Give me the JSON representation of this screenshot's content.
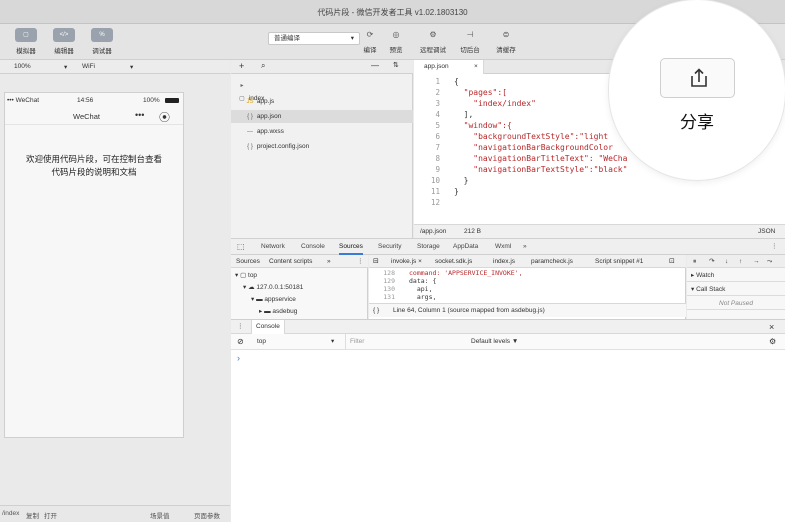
{
  "window": {
    "title": "代码片段 - 微信开发者工具 v1.02.1803130"
  },
  "toolbar": {
    "left_tools": [
      {
        "icon": "simulator-icon",
        "glyph": "▢",
        "label": "模拟器"
      },
      {
        "icon": "editor-icon",
        "glyph": "</>",
        "label": "编辑器"
      },
      {
        "icon": "debugger-icon",
        "glyph": "%",
        "label": "调试器"
      }
    ],
    "compile_mode": "普通编译",
    "actions": [
      {
        "icon": "compile-icon",
        "glyph": "⟳",
        "label": "编译"
      },
      {
        "icon": "preview-icon",
        "glyph": "◎",
        "label": "预览"
      },
      {
        "icon": "remote-debug-icon",
        "glyph": "⚙",
        "label": "远程调试"
      },
      {
        "icon": "background-icon",
        "glyph": "⊣",
        "label": "切后台"
      },
      {
        "icon": "clear-cache-icon",
        "glyph": "⊜",
        "label": "清缓存"
      }
    ]
  },
  "simulator": {
    "zoom": "100%",
    "network": "WiFi",
    "carrier": "••• WeChat",
    "time": "14:56",
    "battery": "100%",
    "nav_title": "WeChat",
    "body_lines": [
      "欢迎使用代码片段，可在控制台查看",
      "代码片段的说明和文档"
    ]
  },
  "statusbar": {
    "path": "/index",
    "actions": [
      "复制",
      "打开"
    ],
    "right": [
      "场景值",
      "页面参数"
    ]
  },
  "tree": {
    "items": [
      {
        "name": "index",
        "icon": "▸ ▢",
        "selected": false
      },
      {
        "name": "app.js",
        "icon": "JS",
        "selected": false
      },
      {
        "name": "app.json",
        "icon": "{ }",
        "selected": true
      },
      {
        "name": "app.wxss",
        "icon": "—",
        "selected": false
      },
      {
        "name": "project.config.json",
        "icon": "{ }",
        "selected": false
      }
    ]
  },
  "editor": {
    "tab": "app.json",
    "lines": [
      "{",
      "  \"pages\":[",
      "    \"index/index\"",
      "  ],",
      "  \"window\":{",
      "    \"backgroundTextStyle\":\"light",
      "    \"navigationBarBackgroundColor",
      "    \"navigationBarTitleText\": \"WeCha",
      "    \"navigationBarTextStyle\":\"black\"",
      "  }",
      "}",
      ""
    ],
    "status_path": "/app.json",
    "status_size": "212 B",
    "status_lang": "JSON"
  },
  "devtools": {
    "tabs": [
      "Network",
      "Console",
      "Sources",
      "Security",
      "Storage",
      "AppData",
      "Wxml",
      "»"
    ],
    "active_tab": "Sources",
    "sources_tabs": [
      "Sources",
      "Content scripts",
      "»"
    ],
    "tree": [
      "▾ ▢ top",
      "▾ ☁ 127.0.0.1:50181",
      "▾ ▬ appservice",
      "▸ ▬ asdebug"
    ],
    "file_tabs": [
      "invoke.js ×",
      "socket.sdk.js",
      "index.js",
      "paramcheck.js",
      "Script snippet #1"
    ],
    "code": [
      {
        "n": "128",
        "t": "command: 'APPSERVICE_INVOKE',"
      },
      {
        "n": "129",
        "t": "data: {"
      },
      {
        "n": "130",
        "t": "  api,"
      },
      {
        "n": "131",
        "t": "  args,"
      }
    ],
    "mid_status": "Line 64, Column 1  (source mapped from asdebug.js)",
    "right_panels": [
      "▸ Watch",
      "▾ Call Stack",
      "Not Paused"
    ],
    "console_title": "Console",
    "console_context": "top",
    "console_filter": "Filter",
    "console_levels": "Default levels ▼",
    "console_prompt": "›"
  },
  "share": {
    "label": "分享"
  }
}
